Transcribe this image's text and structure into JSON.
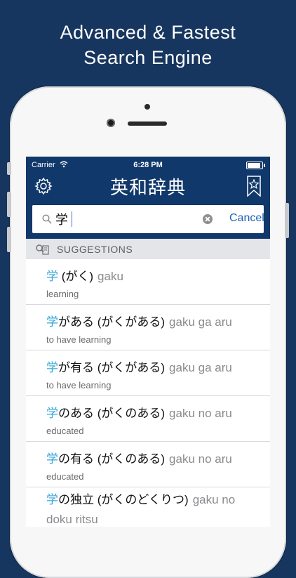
{
  "promo": {
    "line1": "Advanced & Fastest",
    "line2": "Search Engine"
  },
  "status_bar": {
    "carrier": "Carrier",
    "time": "6:28 PM"
  },
  "navbar": {
    "title": "英和辞典",
    "settings_icon": "gear-icon",
    "bookmarks_icon": "bookmark-star-icon"
  },
  "search": {
    "value": "学",
    "cancel_label": "Cancel"
  },
  "suggestions": {
    "header": "SUGGESTIONS",
    "items": [
      {
        "match": "学",
        "rest": " (がく)",
        "romaji": "gaku",
        "meaning": "learning"
      },
      {
        "match": "学",
        "rest": "がある (がくがある)",
        "romaji": "gaku ga aru",
        "meaning": "to have learning"
      },
      {
        "match": "学",
        "rest": "が有る (がくがある)",
        "romaji": "gaku ga aru",
        "meaning": "to have learning"
      },
      {
        "match": "学",
        "rest": "のある (がくのある)",
        "romaji": "gaku no aru",
        "meaning": "educated"
      },
      {
        "match": "学",
        "rest": "の有る (がくのある)",
        "romaji": "gaku no aru",
        "meaning": "educated"
      },
      {
        "match": "学",
        "rest": "の独立 (がくのどくりつ)",
        "romaji": "gaku no doku ritsu",
        "meaning": ""
      }
    ]
  },
  "colors": {
    "background": "#16365f",
    "nav": "#11386a",
    "highlight": "#34a7d9",
    "link": "#1d62b8"
  }
}
